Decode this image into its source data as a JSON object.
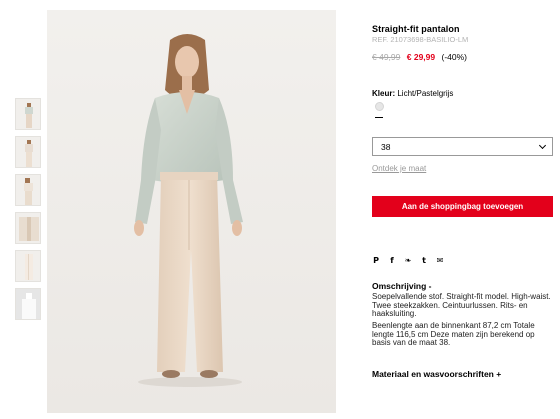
{
  "product": {
    "title": "Straight-fit pantalon",
    "ref": "REF. 21073698-BASILIO-LM",
    "old_price": "€ 49,99",
    "new_price": "€ 29,99",
    "discount": "(-40%)"
  },
  "color": {
    "label": "Kleur:",
    "value": "Licht/Pastelgrijs",
    "swatch_hex": "#e6e6e6"
  },
  "size": {
    "selected": "38",
    "find_size_link": "Ontdek je maat"
  },
  "cart": {
    "add_label": "Aan de shoppingbag toevoegen",
    "button_color": "#e3001b"
  },
  "share": {
    "icons": [
      "pinterest-icon",
      "facebook-icon",
      "twitter-icon",
      "tumblr-icon",
      "email-icon"
    ],
    "glyphs": [
      "P",
      "f",
      "❧",
      "t",
      "✉"
    ]
  },
  "description": {
    "title": "Omschrijving -",
    "text": "Soepelvallende stof. Straight-fit model. High-waist. Twee steekzakken. Ceintuurlussen. Rits- en haaksluiting.",
    "measurements": "Beenlengte aan de binnenkant 87,2 cm Totale lengte 116,5 cm Deze maten zijn berekend op basis van de maat 38."
  },
  "materials": {
    "label": "Materiaal en wasvoorschriften +"
  },
  "thumbnails": {
    "count": 6
  }
}
